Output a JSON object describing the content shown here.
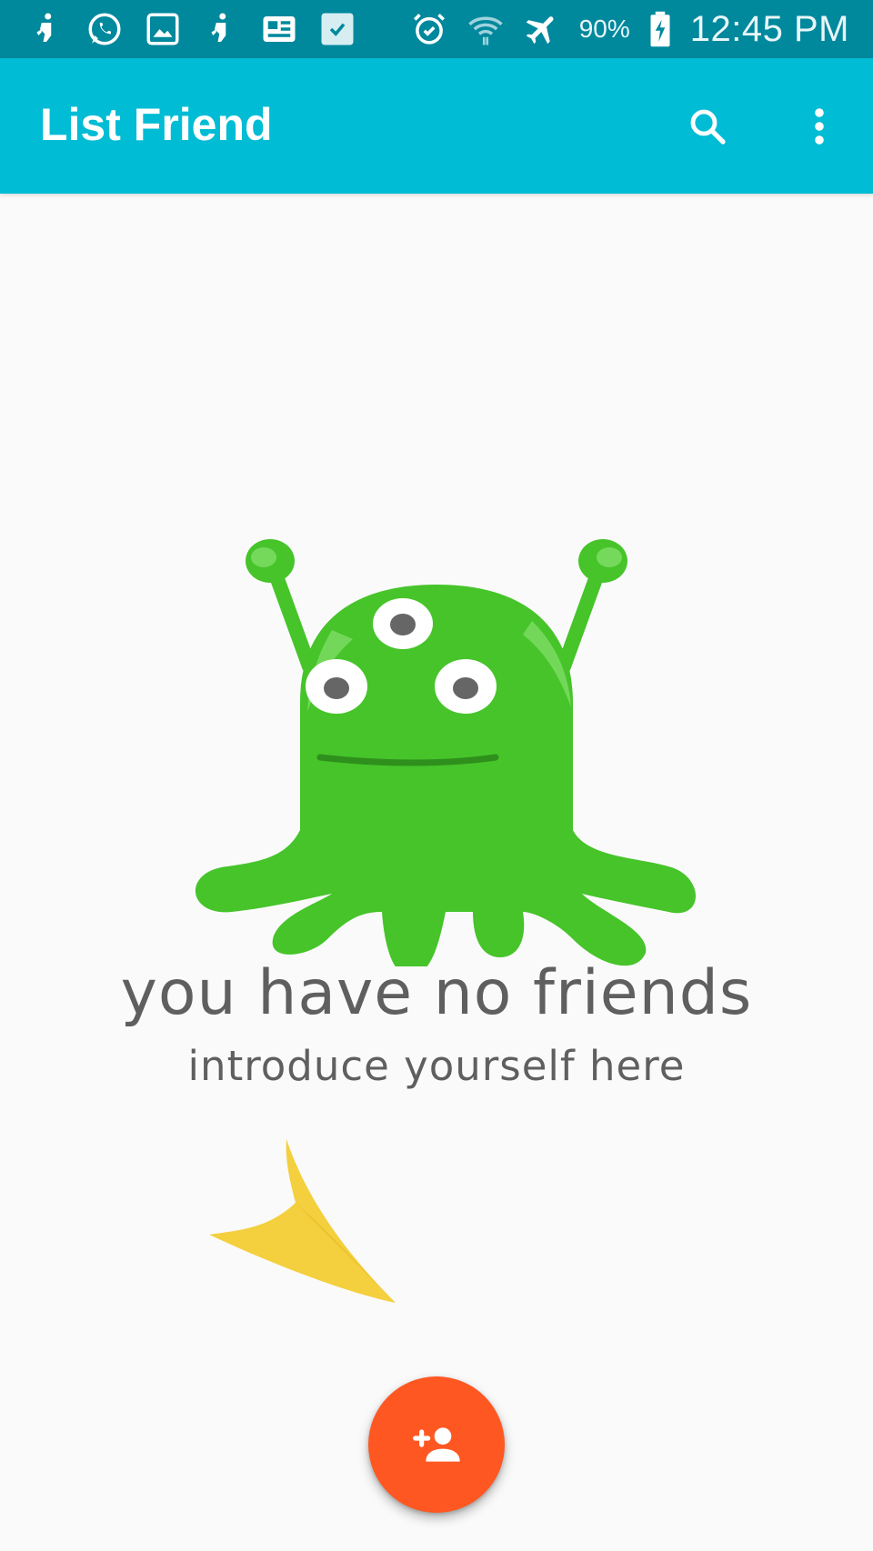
{
  "status_bar": {
    "left_icons": [
      "usb-debug-icon",
      "whatsapp-icon",
      "gallery-icon",
      "usb-debug-icon",
      "news-icon",
      "task-check-icon"
    ],
    "right_icons": [
      "alarm-icon",
      "wifi-icon",
      "airplane-mode-icon",
      "battery-charging-icon"
    ],
    "battery_percent": "90%",
    "time": "12:45 PM",
    "background_color": "#00889c"
  },
  "app_bar": {
    "title": "List Friend",
    "actions": [
      "search-icon",
      "more-vert-icon"
    ],
    "background_color": "#00bcd4"
  },
  "empty_state": {
    "illustration": "green-three-eyed-monster",
    "title": "you have no friends",
    "subtitle": "introduce yourself here",
    "pointer": "yellow-arrow-icon"
  },
  "fab": {
    "icon": "add-person-icon",
    "background_color": "#ff5722"
  }
}
